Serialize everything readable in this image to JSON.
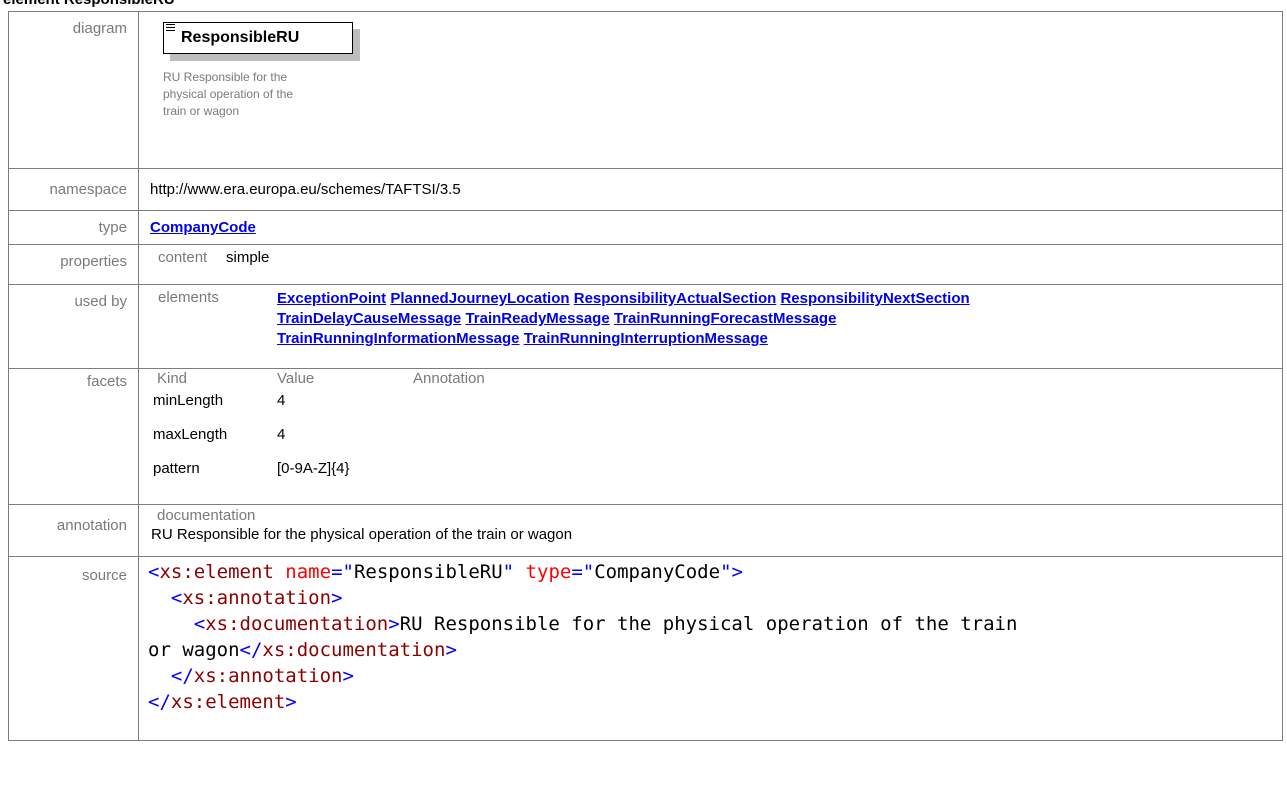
{
  "heading": "element ResponsibleRU",
  "labels": {
    "diagram": "diagram",
    "namespace": "namespace",
    "type": "type",
    "properties": "properties",
    "used_by": "used by",
    "facets": "facets",
    "annotation": "annotation",
    "source": "source"
  },
  "diagram": {
    "element_name": "ResponsibleRU",
    "doc_lines": [
      "RU Responsible for the",
      "physical operation of the",
      "train or wagon"
    ]
  },
  "namespace": "http://www.era.europa.eu/schemes/TAFTSI/3.5",
  "type_link": "CompanyCode",
  "properties": {
    "key": "content",
    "value": "simple"
  },
  "used_by": {
    "key": "elements",
    "links": [
      "ExceptionPoint",
      "PlannedJourneyLocation",
      "ResponsibilityActualSection",
      "ResponsibilityNextSection",
      "TrainDelayCauseMessage",
      "TrainReadyMessage",
      "TrainRunningForecastMessage",
      "TrainRunningInformationMessage",
      "TrainRunningInterruptionMessage"
    ]
  },
  "facets": {
    "headers": [
      "Kind",
      "Value",
      "Annotation"
    ],
    "rows": [
      {
        "kind": "minLength",
        "value": "4"
      },
      {
        "kind": "maxLength",
        "value": "4"
      },
      {
        "kind": "pattern",
        "value": "[0-9A-Z]{4}"
      }
    ]
  },
  "annotation": {
    "key": "documentation",
    "text": "RU Responsible for the physical operation of the train or wagon"
  },
  "source": {
    "el_open": "xs:element",
    "attr_name": "name",
    "attr_name_value": "ResponsibleRU",
    "attr_type": "type",
    "attr_type_value": "CompanyCode",
    "annotation_tag": "xs:annotation",
    "documentation_tag": "xs:documentation",
    "doc_text_line1": "RU Responsible for the physical operation of the train",
    "doc_text_line2": "or wagon"
  },
  "colors": {
    "link": "#0000ee",
    "label_gray": "#7a7a7a",
    "xml_tag": "#8b0000",
    "xml_bracket": "#0000ff",
    "xml_attr": "#ff0000"
  }
}
